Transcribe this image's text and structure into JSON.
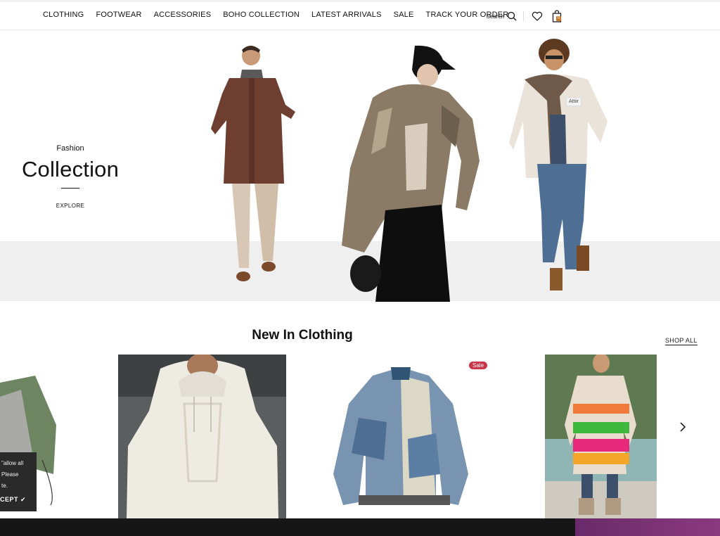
{
  "nav": {
    "items": [
      "CLOTHING",
      "FOOTWEAR",
      "ACCESSORIES",
      "BOHO COLLECTION",
      "LATEST ARRIVALS",
      "SALE",
      "TRACK YOUR ORDER"
    ],
    "search_label": "Search",
    "cart_count": "0"
  },
  "hero": {
    "subtitle": "Fashion",
    "title": "Collection",
    "cta": "EXPLORE",
    "tag": "Attiir"
  },
  "products": {
    "title": "New In Clothing",
    "shop_all": "SHOP ALL",
    "sale_badge": "Sale"
  },
  "cookie": {
    "line1": "\"allow all",
    "line2": "Please",
    "line3": "te.",
    "accept": "CEPT ✔"
  },
  "colors": {
    "accent": "#c8364a",
    "bottom_bar": "#161616",
    "hero_floor": "#efefef"
  }
}
